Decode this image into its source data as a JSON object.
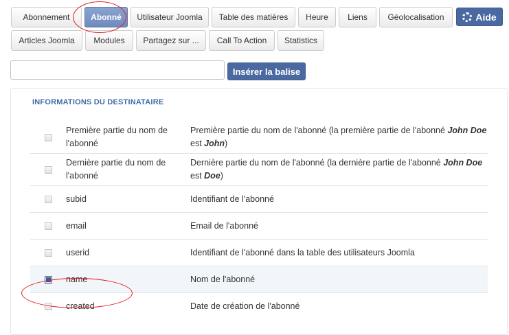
{
  "tabs_row1": [
    "Abonnement",
    "Abonné",
    "Utilisateur Joomla",
    "Table des matières",
    "Heure",
    "Liens",
    "Géolocalisation"
  ],
  "tabs_row2": [
    "Articles Joomla",
    "Modules",
    "Partagez sur ...",
    "Call To Action",
    "Statistics"
  ],
  "active_tab": "Abonné",
  "help_label": "Aide",
  "tag_input": {
    "value": "",
    "placeholder": ""
  },
  "insert_label": "Insérer la balise",
  "section_title": "INFORMATIONS DU DESTINATAIRE",
  "rows": [
    {
      "name": "Première partie du nom de l'abonné",
      "desc_pre": "Première partie du nom de l'abonné (la première partie de l'abonné ",
      "desc_b1": "John Doe",
      "desc_mid": " est ",
      "desc_b2": "John",
      "desc_post": ")",
      "checked": false
    },
    {
      "name": "Dernière partie du nom de l'abonné",
      "desc_pre": "Dernière partie du nom de l'abonné (la dernière partie de l'abonné ",
      "desc_b1": "John Doe",
      "desc_mid": " est ",
      "desc_b2": "Doe",
      "desc_post": ")",
      "checked": false
    },
    {
      "name": "subid",
      "desc": "Identifiant de l'abonné",
      "checked": false
    },
    {
      "name": "email",
      "desc": "Email de l'abonné",
      "checked": false
    },
    {
      "name": "userid",
      "desc": "Identifiant de l'abonné dans la table des utilisateurs Joomla",
      "checked": false
    },
    {
      "name": "name",
      "desc": "Nom de l'abonné",
      "checked": true
    },
    {
      "name": "created",
      "desc": "Date de création de l'abonné",
      "checked": false
    }
  ],
  "colors": {
    "accent": "#4a69a0",
    "active_tab": "#7b96c6",
    "highlight_ellipse": "#e31b1b",
    "section_title": "#3e6ba6"
  }
}
